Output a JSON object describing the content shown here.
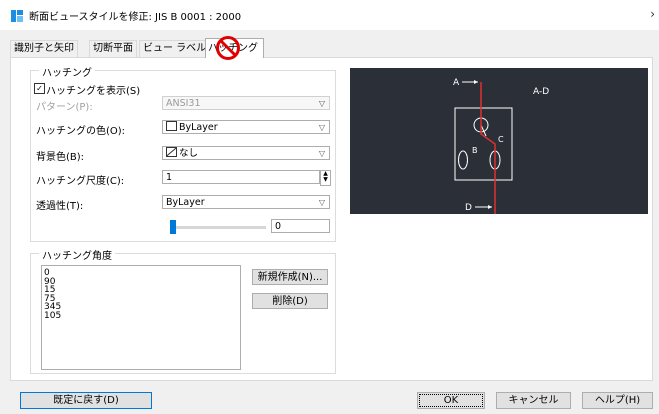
{
  "window": {
    "title": "断面ビュースタイルを修正: JIS B 0001 : 2000",
    "icon": "app-style-icon",
    "close_chevron": "›"
  },
  "tabs": [
    {
      "label": "識別子と矢印"
    },
    {
      "label": "切断平面"
    },
    {
      "label": "ビュー ラベル"
    },
    {
      "label": "ハッチング"
    }
  ],
  "no_symbol_color": "#e00000",
  "hatching": {
    "group_label": "ハッチング",
    "show_hatch_label": "ハッチングを表示(S)",
    "show_hatch_checked": "✓",
    "pattern_label": "パターン(P):",
    "pattern_value": "ANSI31",
    "color_label": "ハッチングの色(O):",
    "color_value": "ByLayer",
    "bg_label": "背景色(B):",
    "bg_value": "なし",
    "scale_label": "ハッチング尺度(C):",
    "scale_value": "1",
    "transparency_label": "透過性(T):",
    "transparency_value": "ByLayer",
    "transparency_number": "0",
    "slider_level": 0
  },
  "angles": {
    "group_label": "ハッチング角度",
    "values": [
      "0",
      "90",
      "15",
      "75",
      "345",
      "105"
    ],
    "new_button": "新規作成(N)...",
    "delete_button": "削除(D)"
  },
  "preview": {
    "label_a": "A",
    "label_ad": "A-D",
    "label_b": "B",
    "label_c": "C",
    "label_d": "D",
    "bg_color": "#2b2f37",
    "cut_line_color": "#e03030"
  },
  "footer": {
    "reset_button": "既定に戻す(D)",
    "ok_button": "OK",
    "cancel_button": "キャンセル",
    "help_button": "ヘルプ(H)"
  }
}
